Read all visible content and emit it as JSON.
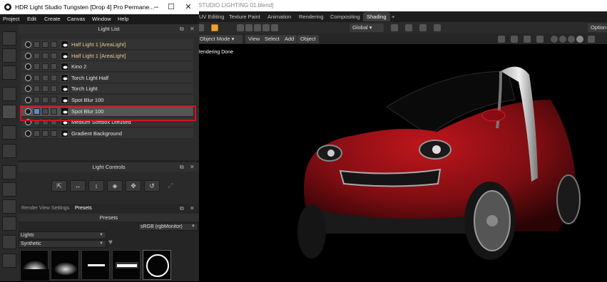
{
  "blender": {
    "title": "STUDIO LIGHTING 01.blend]",
    "tabs": [
      "UV Editing",
      "Texture Paint",
      "Animation",
      "Rendering",
      "Compositing",
      "Shading"
    ],
    "active_tab": "Shading",
    "add_tab": "+",
    "transform_orientation": "Global",
    "options_label": "Option",
    "mode": "Object Mode",
    "menus": [
      "View",
      "Select",
      "Add",
      "Object"
    ],
    "status": "Rendering Done"
  },
  "hls": {
    "title": "HDR Light Studio Tungsten [Drop 4]  Pro Permane...",
    "window_controls": [
      "–",
      "☐",
      "✕"
    ],
    "menu": [
      "Project",
      "Edit",
      "Create",
      "Canvas",
      "Window",
      "Help"
    ],
    "panels": {
      "light_list": "Light List",
      "light_controls": "Light Controls",
      "presets": "Presets"
    },
    "panel_icons": [
      "⧉",
      "✕"
    ],
    "lights": [
      {
        "name": "Half Light 1 [AreaLight]",
        "warm": true
      },
      {
        "name": "Half Light 1 [AreaLight]",
        "warm": true
      },
      {
        "name": "Kino 2",
        "warm": false
      },
      {
        "name": "Torch Light Half",
        "warm": false
      },
      {
        "name": "Torch Light",
        "warm": false
      },
      {
        "name": "Spot Blur 100",
        "warm": false
      },
      {
        "name": "Spot Blur 100",
        "warm": false,
        "selected": true
      },
      {
        "name": "Medium Softbox Diffused",
        "warm": false
      },
      {
        "name": "Gradient Background",
        "warm": false
      }
    ],
    "bottom_tabs": [
      "Render View Settings",
      "Presets"
    ],
    "active_bottom_tab": "Presets",
    "colorspace": "sRGB (rgbMonitor)",
    "preset_category": "Lights",
    "preset_subcategory": "Synthetic",
    "colors": {
      "highlight": "#d5141d",
      "car_body": "#a3141a",
      "selected_row": "#555555",
      "warm_text": "#e6c98e"
    }
  }
}
